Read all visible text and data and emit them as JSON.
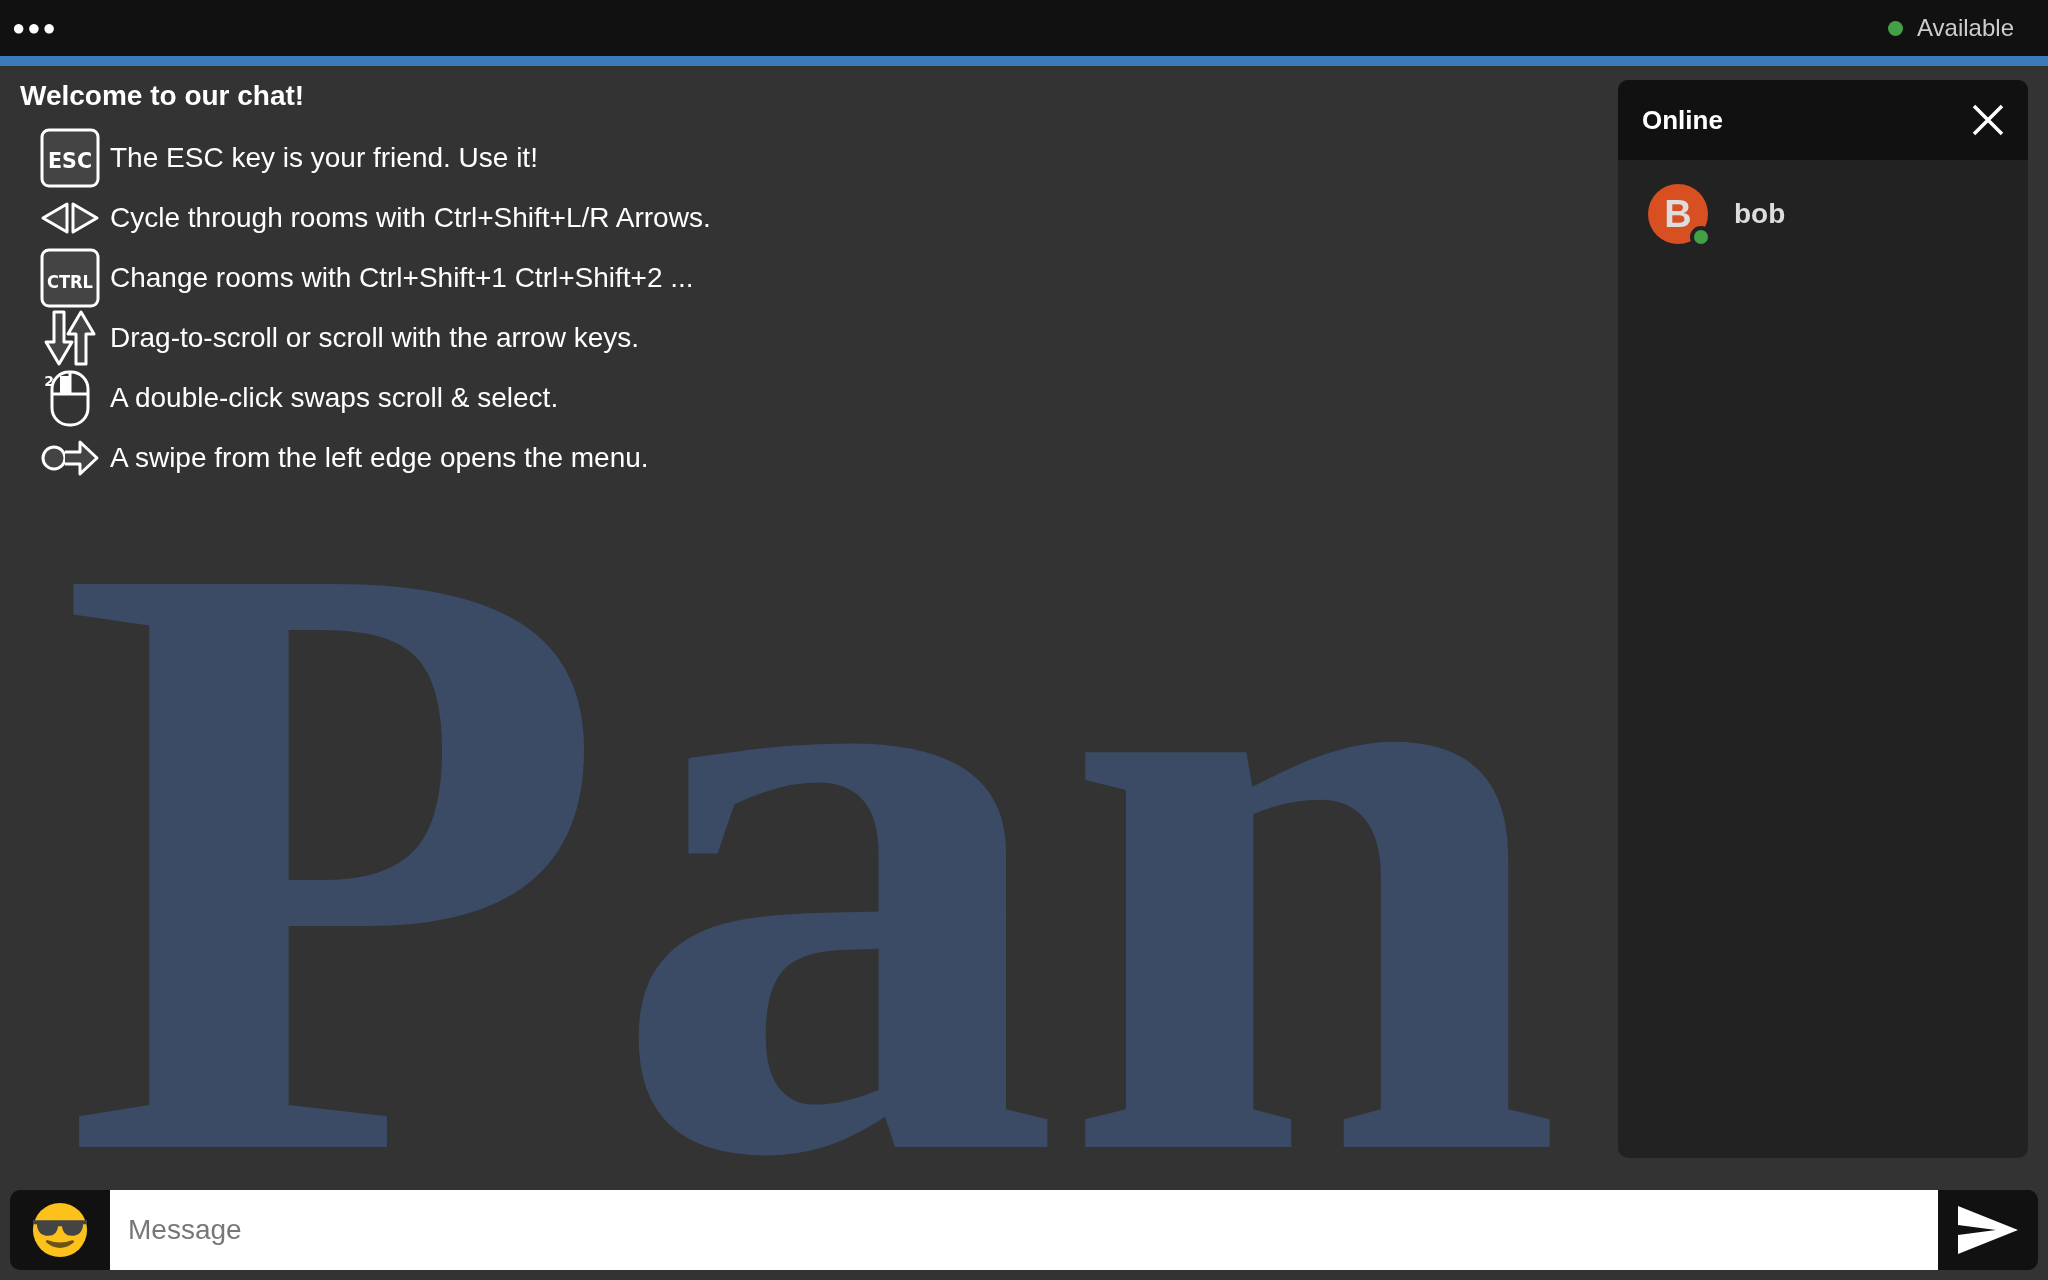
{
  "top_bar": {
    "menu_dots": "●●●",
    "status": {
      "label": "Available",
      "color": "#43a047"
    }
  },
  "chat": {
    "background_text": "Pan",
    "welcome": "Welcome to our chat!",
    "tips": [
      {
        "kind": "key",
        "key": "ESC",
        "text": "The ESC key is your friend. Use it!"
      },
      {
        "kind": "arrows",
        "text": "Cycle through rooms with Ctrl+Shift+L/R Arrows."
      },
      {
        "kind": "key",
        "key": "CTRL",
        "text": "Change rooms with Ctrl+Shift+1 Ctrl+Shift+2 ..."
      },
      {
        "kind": "updown",
        "text": "Drag-to-scroll or scroll with the arrow keys."
      },
      {
        "kind": "mouse",
        "key": "2",
        "text": "A double-click swaps scroll & select."
      },
      {
        "kind": "swipe",
        "text": "A swipe from the left edge opens the menu."
      }
    ]
  },
  "online_panel": {
    "title": "Online",
    "users": [
      {
        "initial": "B",
        "name": "bob",
        "color": "#d84f22",
        "online": true
      }
    ]
  },
  "composer": {
    "placeholder": "Message"
  }
}
